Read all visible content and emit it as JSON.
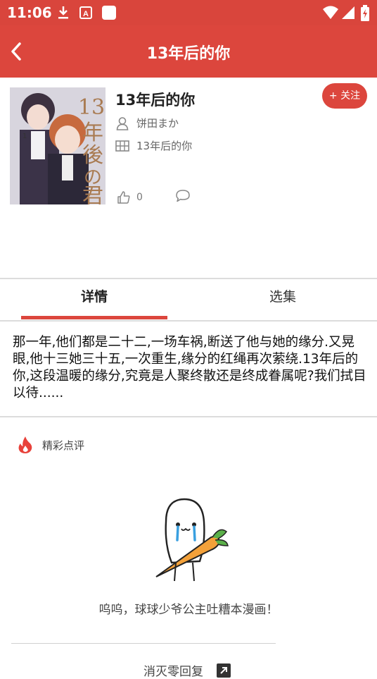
{
  "status_bar": {
    "time": "11:06",
    "icons": [
      "download-icon",
      "a-icon",
      "square-icon",
      "wifi-icon",
      "signal-icon",
      "battery-icon"
    ]
  },
  "app_bar": {
    "title": "13年后的你",
    "back_icon": "chevron-left-icon",
    "color": "#dc463d"
  },
  "manga": {
    "title": "13年后的你",
    "author": "饼田まか",
    "series": "13年后的你",
    "likes": "0",
    "follow_label": "+ 关注",
    "cover_art_text": "13年後の君"
  },
  "tabs": [
    {
      "label": "详情",
      "active": true
    },
    {
      "label": "选集",
      "active": false
    }
  ],
  "description": "那一年,他们都是二十二,一场车祸,断送了他与她的缘分.又晃眼,他十三她三十五,一次重生,缘分的红绳再次萦绕.13年后的你,这段温暖的缘分,究竟是人聚终散还是终成眷属呢?我们拭目以待......",
  "comments": {
    "header": "精彩点评",
    "empty_text": "呜呜，球球少爷公主吐糟本漫画！",
    "more_label": "消灭零回复"
  }
}
